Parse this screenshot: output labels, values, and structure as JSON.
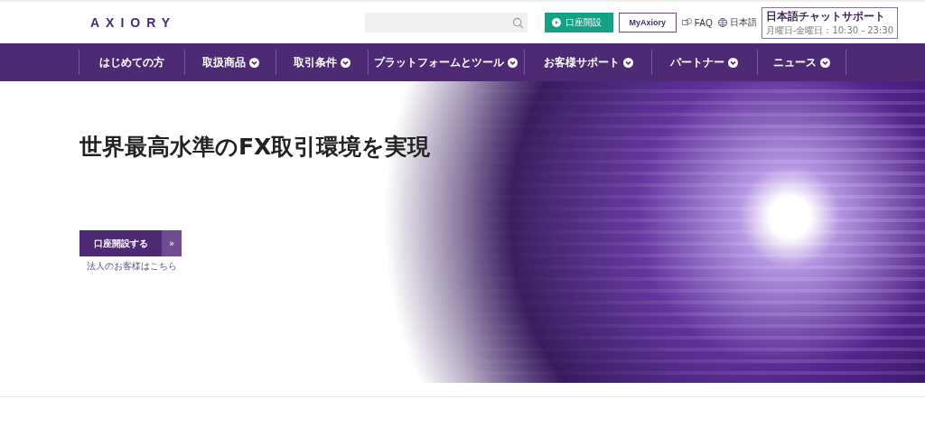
{
  "header": {
    "logo": "AXIORY",
    "open_account": "口座開設",
    "my_account": "MyAxiory",
    "faq": "FAQ",
    "language": "日本語",
    "chat_support": {
      "title": "日本語チャットサポート",
      "hours": "月曜日-金曜日：10:30 - 23:30"
    }
  },
  "nav": [
    {
      "label": "はじめての方",
      "has_menu": false
    },
    {
      "label": "取扱商品",
      "has_menu": true
    },
    {
      "label": "取引条件",
      "has_menu": true
    },
    {
      "label": "プラットフォームとツール",
      "has_menu": true
    },
    {
      "label": "お客様サポート",
      "has_menu": true
    },
    {
      "label": "パートナー",
      "has_menu": true
    },
    {
      "label": "ニュース",
      "has_menu": true
    }
  ],
  "hero": {
    "headline": "世界最高水準のFX取引環境を実現",
    "cta": "口座開設する",
    "cta_arrow": "»",
    "corporate_link": "法人のお客様はこちら"
  }
}
